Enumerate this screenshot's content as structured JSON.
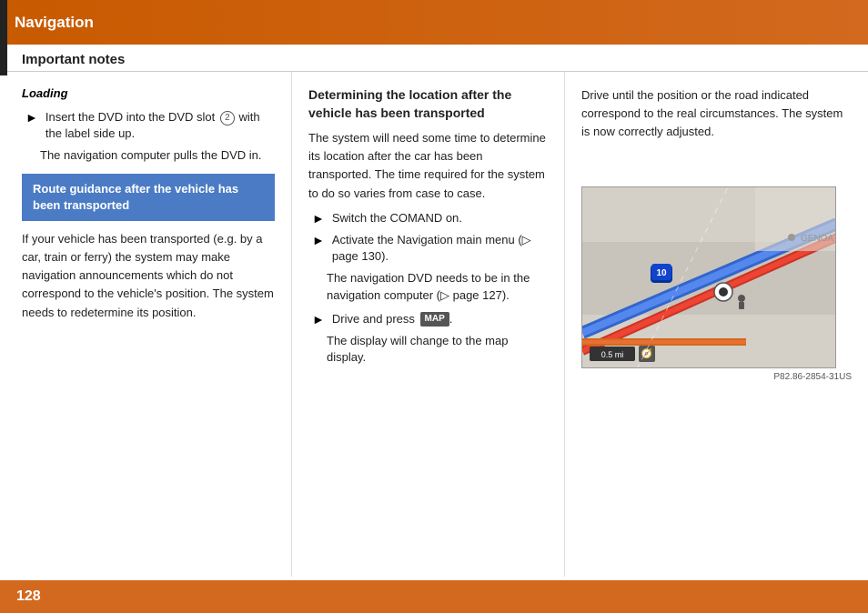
{
  "header": {
    "title": "Navigation",
    "black_bar": true
  },
  "subheader": {
    "title": "Important notes"
  },
  "left_column": {
    "loading_label": "Loading",
    "bullet1": {
      "arrow": "►",
      "text_before": "Insert the DVD into the DVD slot",
      "circle_num": "2",
      "text_after": "with the label side up."
    },
    "sub_text": "The navigation computer pulls the DVD in.",
    "highlight_box": "Route guidance after the vehicle has been transported",
    "body_text": "If your vehicle has been transported (e.g. by a car, train or ferry) the system may make navigation announcements which do not correspond to the vehicle's position. The system needs to redetermine its position."
  },
  "mid_column": {
    "section_title": "Determining the location after the vehicle has been transported",
    "intro_text": "The system will need some time to determine its location after the car has been transported. The time required for the system to do so varies from case to case.",
    "bullet1": {
      "arrow": "►",
      "text": "Switch the COMAND on."
    },
    "bullet2": {
      "arrow": "►",
      "text": "Activate the Navigation main menu (▷ page 130)."
    },
    "sub_text2": "The navigation DVD needs to be in the navigation computer (▷ page 127).",
    "bullet3": {
      "arrow": "►",
      "text_before": "Drive and press",
      "map_button": "MAP",
      "text_after": "."
    },
    "sub_text3": "The display will change to the map display."
  },
  "right_column": {
    "body_text": "Drive until the position or the road indicated correspond to the real circumstances. The system is now correctly adjusted.",
    "map_caption": "P82.86-2854-31US",
    "map": {
      "genoa_label": "GENOA",
      "distance_label": "0.5 mi",
      "highway_num": "10"
    }
  },
  "footer": {
    "page_num": "128"
  }
}
